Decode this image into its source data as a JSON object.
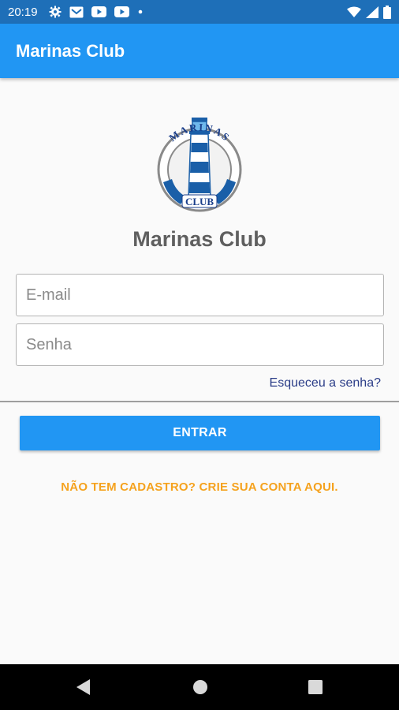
{
  "status_bar": {
    "time": "20:19",
    "icons": [
      "gear-icon",
      "gmail-icon",
      "youtube-icon",
      "youtube-icon",
      "dot-icon",
      "wifi-icon",
      "signal-icon",
      "battery-icon"
    ]
  },
  "app_bar": {
    "title": "Marinas Club"
  },
  "logo": {
    "top_text": "MARINAS",
    "bottom_text": "CLUB"
  },
  "brand": {
    "title": "Marinas Club"
  },
  "form": {
    "email_placeholder": "E-mail",
    "email_value": "",
    "password_placeholder": "Senha",
    "password_value": "",
    "forgot_label": "Esqueceu a senha?",
    "login_label": "ENTRAR",
    "signup_label": "NÃO TEM CADASTRO? CRIE SUA CONTA AQUI."
  },
  "colors": {
    "primary": "#2196f3",
    "status_bar": "#1e6fb8",
    "accent_orange": "#f5a21e",
    "link_blue": "#2b3d88",
    "title_gray": "#5f5f5f"
  }
}
